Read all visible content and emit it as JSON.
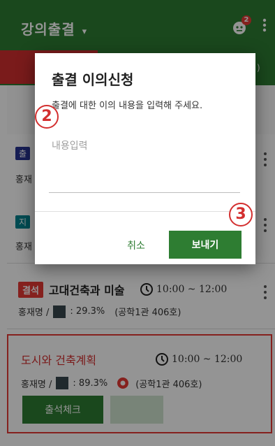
{
  "header": {
    "title": "강의출결",
    "caret": "▾",
    "notification_count": "2"
  },
  "tabs": {
    "right_fragment": ")"
  },
  "list": [
    {
      "status_fragment": "출",
      "status_color": "#283593",
      "professor_fragment": "홍재"
    },
    {
      "status_fragment": "지",
      "status_color": "#00838f",
      "professor_fragment": "홍재"
    },
    {
      "status": "결석",
      "course": "고대건축과 미술",
      "time": "10:00 ~ 12:00",
      "professor": "홍재명 /",
      "rate": ": 29.3%",
      "room": "(공학1관 406호)"
    }
  ],
  "highlighted": {
    "course": "도시와 건축계획",
    "time": "10:00 ~ 12:00",
    "professor": "홍재명 /",
    "rate": ": 89.3%",
    "room": "(공학1관 406호)",
    "check_button": "출석체크"
  },
  "dialog": {
    "title": "출결 이의신청",
    "subtitle": "출결에 대한 이의 내용을 입력해 주세요.",
    "placeholder": "내용입력",
    "cancel": "취소",
    "send": "보내기"
  },
  "markers": [
    "2",
    "3"
  ],
  "colors": {
    "primary": "#2e7d32",
    "accent": "#d32f2f"
  }
}
